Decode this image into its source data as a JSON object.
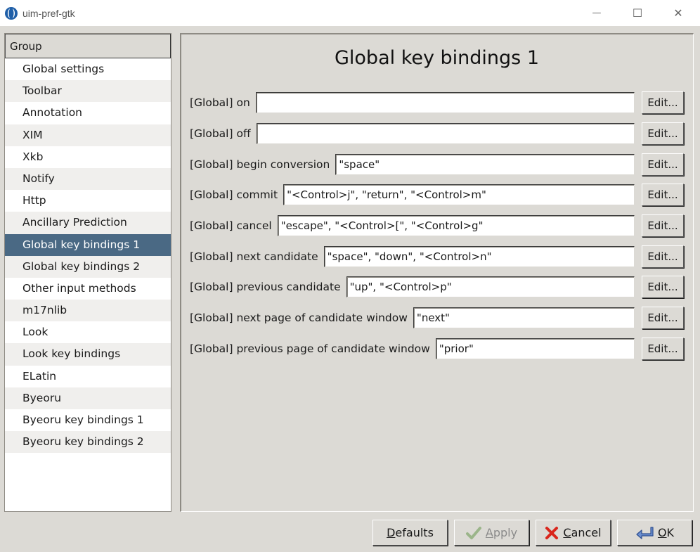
{
  "window": {
    "title": "uim-pref-gtk",
    "minimize_glyph": "—",
    "maximize_glyph": "☐",
    "close_glyph": "✕"
  },
  "sidebar": {
    "header": "Group",
    "items": [
      {
        "label": "Global settings"
      },
      {
        "label": "Toolbar"
      },
      {
        "label": "Annotation"
      },
      {
        "label": "XIM"
      },
      {
        "label": "Xkb"
      },
      {
        "label": "Notify"
      },
      {
        "label": "Http"
      },
      {
        "label": "Ancillary Prediction"
      },
      {
        "label": "Global key bindings 1",
        "selected": true
      },
      {
        "label": "Global key bindings 2"
      },
      {
        "label": "Other input methods"
      },
      {
        "label": "m17nlib"
      },
      {
        "label": "Look"
      },
      {
        "label": "Look key bindings"
      },
      {
        "label": "ELatin"
      },
      {
        "label": "Byeoru"
      },
      {
        "label": "Byeoru key bindings 1"
      },
      {
        "label": "Byeoru key bindings 2"
      }
    ],
    "selected_color": "#4a6984"
  },
  "main": {
    "title": "Global key bindings 1",
    "rows": [
      {
        "label": "[Global] on",
        "value": "",
        "button": "Edit..."
      },
      {
        "label": "[Global] off",
        "value": "",
        "button": "Edit..."
      },
      {
        "label": "[Global] begin conversion",
        "value": "\"space\"",
        "button": "Edit..."
      },
      {
        "label": "[Global] commit",
        "value": "\"<Control>j\", \"return\", \"<Control>m\"",
        "button": "Edit..."
      },
      {
        "label": "[Global] cancel",
        "value": "\"escape\", \"<Control>[\", \"<Control>g\"",
        "button": "Edit..."
      },
      {
        "label": "[Global] next candidate",
        "value": "\"space\", \"down\", \"<Control>n\"",
        "button": "Edit..."
      },
      {
        "label": "[Global] previous candidate",
        "value": "\"up\", \"<Control>p\"",
        "button": "Edit..."
      },
      {
        "label": "[Global] next page of candidate window",
        "value": "\"next\"",
        "button": "Edit..."
      },
      {
        "label": "[Global] previous page of candidate window",
        "value": "\"prior\"",
        "button": "Edit..."
      }
    ]
  },
  "footer": {
    "defaults": {
      "mnemonic": "D",
      "rest": "efaults"
    },
    "apply": {
      "mnemonic": "A",
      "rest": "pply",
      "enabled": false
    },
    "cancel": {
      "mnemonic": "C",
      "rest": "ancel"
    },
    "ok": {
      "mnemonic": "O",
      "rest": "K"
    }
  }
}
